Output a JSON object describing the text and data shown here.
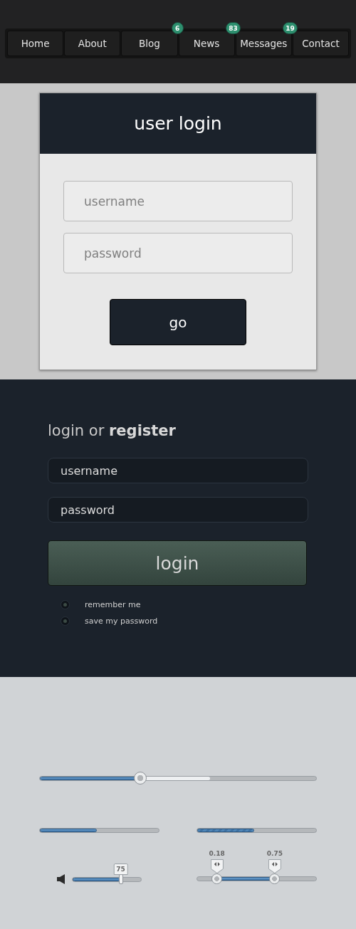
{
  "nav": {
    "items": [
      {
        "label": "Home",
        "selected": false
      },
      {
        "label": "About",
        "selected": false
      },
      {
        "label": "Blog",
        "selected": false,
        "badge": "6"
      },
      {
        "label": "News",
        "selected": false,
        "badge": "83"
      },
      {
        "label": "Messages",
        "selected": false,
        "badge": "19"
      },
      {
        "label": "Contact",
        "selected": false
      }
    ]
  },
  "user_login": {
    "title": "user login",
    "fields": [
      {
        "placeholder": "username"
      },
      {
        "placeholder": "password"
      }
    ],
    "button": "go"
  },
  "login_panel": {
    "heading": "login or **register**",
    "fields": [
      {
        "placeholder": "username"
      },
      {
        "placeholder": "password"
      }
    ],
    "button": "login",
    "options": [
      {
        "label": "remember me",
        "checked": false
      },
      {
        "label": "save my password",
        "checked": false
      }
    ]
  },
  "controls": {
    "seek_slider": {
      "level": 0.365,
      "buffer": {
        "level": 0.615
      }
    },
    "progress_bars": [
      {
        "kind": "plain",
        "level": 0.48
      },
      {
        "kind": "striped",
        "level": 0.48
      }
    ],
    "volume_slider": {
      "level": 0.7,
      "reading": "75"
    },
    "range_slider": {
      "low": {
        "level": 0.17,
        "reading": "0.18"
      },
      "high": {
        "level": 0.65,
        "reading": "0.75"
      }
    }
  }
}
